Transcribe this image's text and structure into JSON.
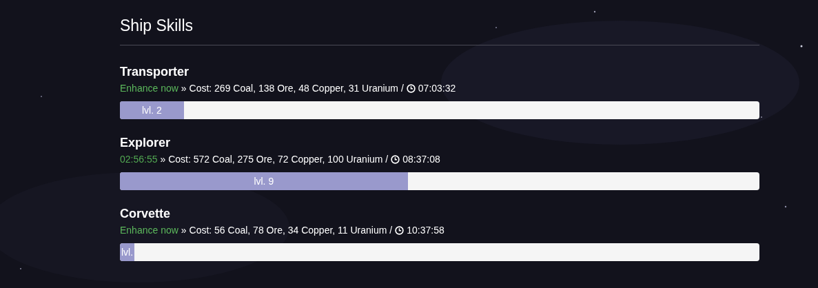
{
  "title": "Ship Skills",
  "skills": [
    {
      "name": "Transporter",
      "action": {
        "kind": "link",
        "text": "Enhance now"
      },
      "cost": "» Cost: 269 Coal, 138 Ore, 48 Copper, 31 Uranium /",
      "time": "07:03:32",
      "level": 0.1,
      "level_label": "lvl. 2"
    },
    {
      "name": "Explorer",
      "action": {
        "kind": "timer",
        "text": "02:56:55"
      },
      "cost": "» Cost: 572 Coal, 275 Ore, 72 Copper, 100 Uranium /",
      "time": "08:37:08",
      "level": 0.45,
      "level_label": "lvl. 9"
    },
    {
      "name": "Corvette",
      "action": {
        "kind": "link",
        "text": "Enhance now"
      },
      "cost": "» Cost: 56 Coal, 78 Ore, 34 Copper, 11 Uranium /",
      "time": "10:37:58",
      "level": 0,
      "level_label": "lvl."
    }
  ]
}
